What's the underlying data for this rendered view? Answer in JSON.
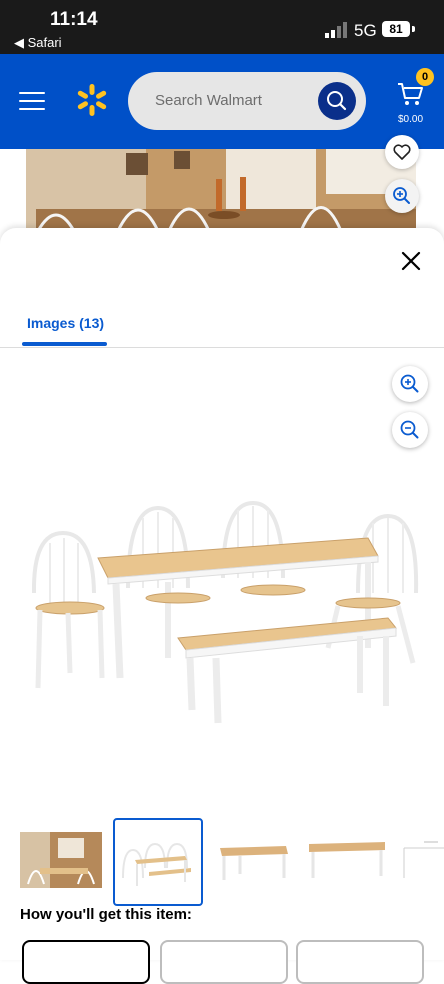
{
  "status_bar": {
    "time": "11:14",
    "back_app": "◀ Safari",
    "network": "5G",
    "battery": "81"
  },
  "header": {
    "search_placeholder": "Search Walmart",
    "cart_count": "0",
    "cart_total": "$0.00",
    "brand_color": "#0050c8",
    "spark_color": "#ffc220"
  },
  "modal": {
    "tab_label": "Images (13)",
    "accent_color": "#0a5bd0"
  },
  "thumbnails": [
    {
      "name": "room-scene",
      "selected": false
    },
    {
      "name": "table-chairs-bench",
      "selected": true
    },
    {
      "name": "table-only",
      "selected": false
    },
    {
      "name": "table-side",
      "selected": false
    },
    {
      "name": "dimensions",
      "selected": false
    }
  ],
  "section": {
    "heading": "How you'll get this item:"
  },
  "icons": [
    "menu-icon",
    "walmart-spark-icon",
    "search-icon",
    "cart-icon",
    "heart-icon",
    "zoom-in-icon",
    "close-icon",
    "zoom-out-icon"
  ]
}
